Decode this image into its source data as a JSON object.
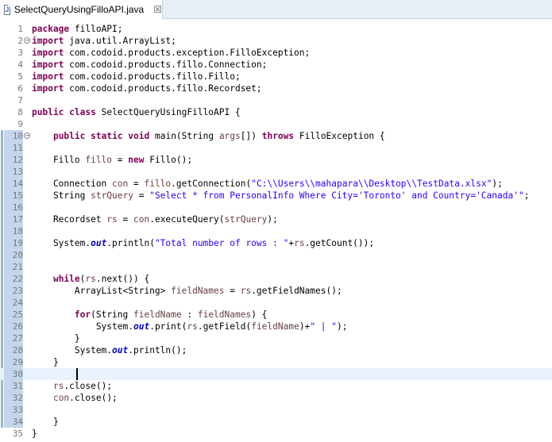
{
  "tab": {
    "title": "SelectQueryUsingFilloAPI.java",
    "icon": "java-file-icon",
    "close_glyph": "☒"
  },
  "editor": {
    "current_line": 30,
    "lines": [
      {
        "n": "1",
        "fold": "",
        "tokens": [
          [
            "kw",
            "package"
          ],
          [
            "t",
            " filloAPI;"
          ]
        ]
      },
      {
        "n": "2",
        "fold": "⊖",
        "tokens": [
          [
            "kw",
            "import"
          ],
          [
            "t",
            " java.util.ArrayList;"
          ]
        ]
      },
      {
        "n": "3",
        "fold": "",
        "tokens": [
          [
            "kw",
            "import"
          ],
          [
            "t",
            " com.codoid.products.exception.FilloException;"
          ]
        ]
      },
      {
        "n": "4",
        "fold": "",
        "tokens": [
          [
            "kw",
            "import"
          ],
          [
            "t",
            " com.codoid.products.fillo.Connection;"
          ]
        ]
      },
      {
        "n": "5",
        "fold": "",
        "tokens": [
          [
            "kw",
            "import"
          ],
          [
            "t",
            " com.codoid.products.fillo.Fillo;"
          ]
        ]
      },
      {
        "n": "6",
        "fold": "",
        "tokens": [
          [
            "kw",
            "import"
          ],
          [
            "t",
            " com.codoid.products.fillo.Recordset;"
          ]
        ]
      },
      {
        "n": "7",
        "fold": "",
        "tokens": []
      },
      {
        "n": "8",
        "fold": "",
        "tokens": [
          [
            "kw",
            "public"
          ],
          [
            "t",
            " "
          ],
          [
            "kw",
            "class"
          ],
          [
            "t",
            " SelectQueryUsingFilloAPI {"
          ]
        ]
      },
      {
        "n": "9",
        "fold": "",
        "tokens": []
      },
      {
        "n": "10",
        "fold": "⊖",
        "tokens": [
          [
            "t",
            "    "
          ],
          [
            "kw",
            "public"
          ],
          [
            "t",
            " "
          ],
          [
            "kw",
            "static"
          ],
          [
            "t",
            " "
          ],
          [
            "kw",
            "void"
          ],
          [
            "t",
            " main(String "
          ],
          [
            "var",
            "args"
          ],
          [
            "t",
            "[]) "
          ],
          [
            "kw",
            "throws"
          ],
          [
            "t",
            " FilloException {"
          ]
        ]
      },
      {
        "n": "11",
        "fold": "",
        "tokens": []
      },
      {
        "n": "12",
        "fold": "",
        "tokens": [
          [
            "t",
            "    Fillo "
          ],
          [
            "var",
            "fillo"
          ],
          [
            "t",
            " = "
          ],
          [
            "kw",
            "new"
          ],
          [
            "t",
            " Fillo();"
          ]
        ]
      },
      {
        "n": "13",
        "fold": "",
        "tokens": []
      },
      {
        "n": "14",
        "fold": "",
        "tokens": [
          [
            "t",
            "    Connection "
          ],
          [
            "var",
            "con"
          ],
          [
            "t",
            " = "
          ],
          [
            "var",
            "fillo"
          ],
          [
            "t",
            ".getConnection("
          ],
          [
            "str",
            "\"C:\\\\Users\\\\mahapara\\\\Desktop\\\\TestData.xlsx\""
          ],
          [
            "t",
            ");"
          ]
        ]
      },
      {
        "n": "15",
        "fold": "",
        "tokens": [
          [
            "t",
            "    String "
          ],
          [
            "var",
            "strQuery"
          ],
          [
            "t",
            " = "
          ],
          [
            "str",
            "\"Select * from PersonalInfo Where City='Toronto' and Country='Canada'\""
          ],
          [
            "t",
            ";"
          ]
        ]
      },
      {
        "n": "16",
        "fold": "",
        "tokens": []
      },
      {
        "n": "17",
        "fold": "",
        "tokens": [
          [
            "t",
            "    Recordset "
          ],
          [
            "var",
            "rs"
          ],
          [
            "t",
            " = "
          ],
          [
            "var",
            "con"
          ],
          [
            "t",
            ".executeQuery("
          ],
          [
            "var",
            "strQuery"
          ],
          [
            "t",
            ");"
          ]
        ]
      },
      {
        "n": "18",
        "fold": "",
        "tokens": []
      },
      {
        "n": "19",
        "fold": "",
        "tokens": [
          [
            "t",
            "    System."
          ],
          [
            "it",
            "out"
          ],
          [
            "t",
            ".println("
          ],
          [
            "str",
            "\"Total number of rows : \""
          ],
          [
            "t",
            "+"
          ],
          [
            "var",
            "rs"
          ],
          [
            "t",
            ".getCount());"
          ]
        ]
      },
      {
        "n": "20",
        "fold": "",
        "tokens": []
      },
      {
        "n": "21",
        "fold": "",
        "tokens": []
      },
      {
        "n": "22",
        "fold": "",
        "tokens": [
          [
            "t",
            "    "
          ],
          [
            "kw",
            "while"
          ],
          [
            "t",
            "("
          ],
          [
            "var",
            "rs"
          ],
          [
            "t",
            ".next()) {"
          ]
        ]
      },
      {
        "n": "23",
        "fold": "",
        "tokens": [
          [
            "t",
            "        ArrayList<String> "
          ],
          [
            "var",
            "fieldNames"
          ],
          [
            "t",
            " = "
          ],
          [
            "var",
            "rs"
          ],
          [
            "t",
            ".getFieldNames();"
          ]
        ]
      },
      {
        "n": "24",
        "fold": "",
        "tokens": []
      },
      {
        "n": "25",
        "fold": "",
        "tokens": [
          [
            "t",
            "        "
          ],
          [
            "kw",
            "for"
          ],
          [
            "t",
            "(String "
          ],
          [
            "var",
            "fieldName"
          ],
          [
            "t",
            " : "
          ],
          [
            "var",
            "fieldNames"
          ],
          [
            "t",
            ") {"
          ]
        ]
      },
      {
        "n": "26",
        "fold": "",
        "tokens": [
          [
            "t",
            "            System."
          ],
          [
            "it",
            "out"
          ],
          [
            "t",
            ".print("
          ],
          [
            "var",
            "rs"
          ],
          [
            "t",
            ".getField("
          ],
          [
            "var",
            "fieldName"
          ],
          [
            "t",
            ")+"
          ],
          [
            "str",
            "\" | \""
          ],
          [
            "t",
            ");"
          ]
        ]
      },
      {
        "n": "27",
        "fold": "",
        "tokens": [
          [
            "t",
            "        }"
          ]
        ]
      },
      {
        "n": "28",
        "fold": "",
        "tokens": [
          [
            "t",
            "        System."
          ],
          [
            "it",
            "out"
          ],
          [
            "t",
            ".println();"
          ]
        ]
      },
      {
        "n": "29",
        "fold": "",
        "tokens": [
          [
            "t",
            "    }"
          ]
        ]
      },
      {
        "n": "30",
        "fold": "",
        "tokens": []
      },
      {
        "n": "31",
        "fold": "",
        "tokens": [
          [
            "t",
            "    "
          ],
          [
            "var",
            "rs"
          ],
          [
            "t",
            ".close();"
          ]
        ]
      },
      {
        "n": "32",
        "fold": "",
        "tokens": [
          [
            "t",
            "    "
          ],
          [
            "var",
            "con"
          ],
          [
            "t",
            ".close();"
          ]
        ]
      },
      {
        "n": "33",
        "fold": "",
        "tokens": []
      },
      {
        "n": "34",
        "fold": "",
        "tokens": [
          [
            "t",
            "    }"
          ]
        ]
      },
      {
        "n": "35",
        "fold": "",
        "tokens": [
          [
            "t",
            "}"
          ]
        ]
      }
    ]
  }
}
